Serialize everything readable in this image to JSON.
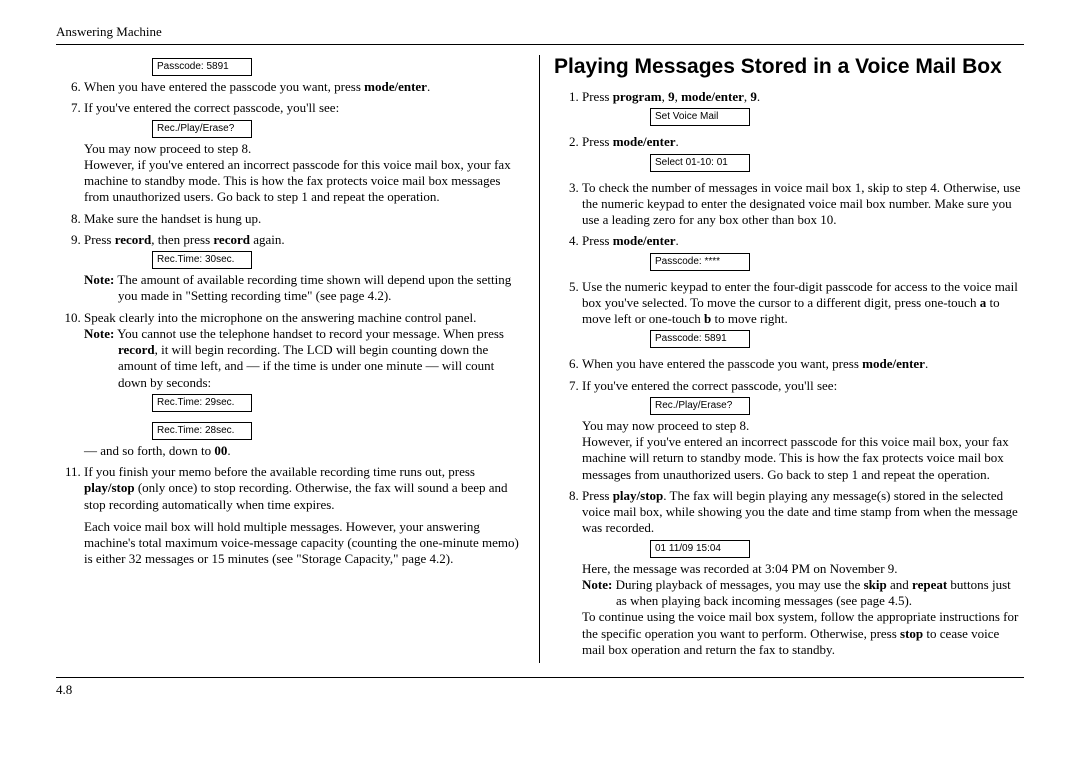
{
  "header": "Answering Machine",
  "footer": "4.8",
  "left": {
    "lcd_passcode": "Passcode:  5891",
    "step6_a": "When you have entered the passcode you want, press ",
    "step6_b": "mode/enter",
    "step6_c": ".",
    "step7": "If you've entered the correct passcode, you'll see:",
    "lcd_rpe": "Rec./Play/Erase?",
    "step7_proceed": "You may now proceed to step 8.",
    "step7_however": "However, if you've entered an incorrect passcode for this voice mail box, your fax machine to standby mode. This is how the fax protects voice mail box messages from unauthorized users. Go back to step 1 and repeat the operation.",
    "step8": "Make sure the handset is hung up.",
    "step9_a": "Press ",
    "step9_b": "record",
    "step9_c": ", then press ",
    "step9_d": "record",
    "step9_e": " again.",
    "lcd_rec30": "Rec.Time: 30sec.",
    "note1_label": "Note:",
    "note1_text": " The amount of available recording time shown will depend upon the setting you made in \"Setting recording time\" (see page 4.2).",
    "step10": "Speak clearly into the microphone on the answering machine control panel.",
    "note2_label": "Note:",
    "note2_a": " You cannot use the telephone handset to record your message. When press ",
    "note2_b": "record",
    "note2_c": ", it will begin recording. The LCD will begin counting down the amount of time left, and — if the time is under one minute — will count down by seconds:",
    "lcd_rec29": "Rec.Time: 29sec.",
    "lcd_rec28": "Rec.Time: 28sec.",
    "and_so_a": "— and so forth, down to ",
    "and_so_b": "00",
    "and_so_c": ".",
    "step11_a": "If you finish your memo before the available recording time runs out, press ",
    "step11_b": "play/stop",
    "step11_c": " (only once) to stop recording. Otherwise, the fax will sound a beep and stop recording automatically when time expires.",
    "para_end": "Each voice mail box will hold multiple messages. However, your answering machine's total maximum voice-message capacity (counting the one-minute memo) is either 32 messages or 15 minutes (see \"Storage Capacity,\" page 4.2)."
  },
  "right": {
    "title": "Playing Messages Stored in a Voice Mail Box",
    "step1_a": "Press ",
    "step1_b": "program",
    "step1_c": ", ",
    "step1_d": "9",
    "step1_e": ", ",
    "step1_f": "mode/enter",
    "step1_g": ", ",
    "step1_h": "9",
    "step1_i": ".",
    "lcd_set": "Set Voice Mail",
    "step2_a": "Press ",
    "step2_b": "mode/enter",
    "step2_c": ".",
    "lcd_select": "Select 01-10: 01",
    "step3": "To check the number of messages in voice mail box 1, skip to step 4. Otherwise, use the numeric keypad to enter the designated voice mail box number. Make sure you use a leading zero for any box other than box 10.",
    "step4_a": "Press ",
    "step4_b": "mode/enter",
    "step4_c": ".",
    "lcd_pass_stars": "Passcode:  ****",
    "step5_a": "Use the numeric keypad to enter the four-digit passcode for access to the voice mail box you've selected. To move the cursor to a different digit, press one-touch ",
    "step5_b": "a",
    "step5_c": " to move left or one-touch ",
    "step5_d": "b",
    "step5_e": " to move right.",
    "lcd_pass_num": "Passcode:  5891",
    "step6_a": "When you have entered the passcode you want, press ",
    "step6_b": "mode/enter",
    "step6_c": ".",
    "step7": "If you've entered the correct passcode, you'll see:",
    "lcd_rpe": "Rec./Play/Erase?",
    "step7_proceed": "You may now proceed to step 8.",
    "step7_however": "However, if you've entered an incorrect passcode for this voice mail box, your fax machine will return to standby mode. This is how the fax protects voice mail box messages from unauthorized users. Go back to step 1 and repeat the operation.",
    "step8_a": "Press ",
    "step8_b": "play/stop",
    "step8_c": ". The fax will begin playing any message(s) stored in the selected voice mail box, while showing you the date and time stamp from when the message was recorded.",
    "lcd_time": "01  11/09  15:04",
    "here": "Here, the message was recorded at 3:04 PM on November 9.",
    "note_label": "Note:",
    "note_a": " During playback of messages, you may use the ",
    "note_b": "skip",
    "note_c": " and ",
    "note_d": "repeat",
    "note_e": " buttons just as when playing back incoming messages (see page 4.5).",
    "cont_a": "To continue using the voice mail box system, follow the appropriate instructions for the specific operation you want to perform. Otherwise, press ",
    "cont_b": "stop",
    "cont_c": " to cease voice mail box operation and return the fax to standby."
  }
}
